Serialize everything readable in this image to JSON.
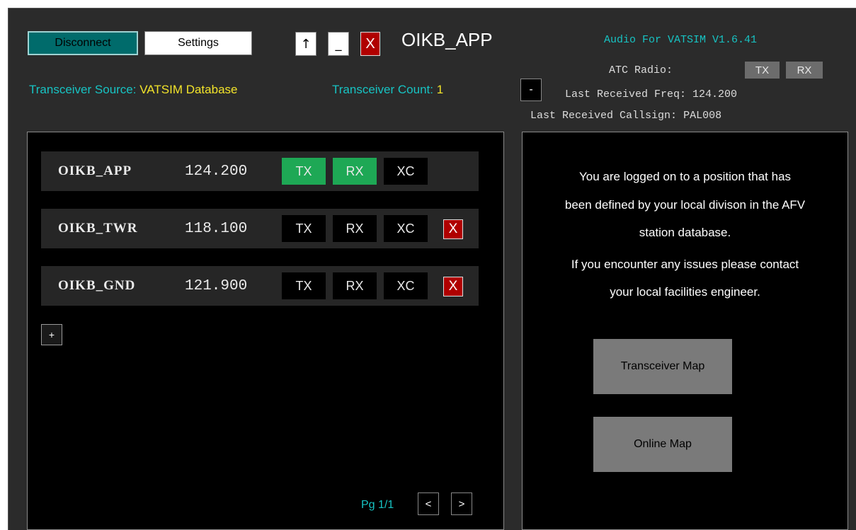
{
  "toolbar": {
    "disconnect_label": "Disconnect",
    "settings_label": "Settings",
    "pin_glyph": "↑",
    "minimize_glyph": "_",
    "close_glyph": "X",
    "callsign": "OIKB_APP"
  },
  "info": {
    "source_label": "Transceiver Source:",
    "source_value": "VATSIM Database",
    "count_label": "Transceiver Count:",
    "count_value": "1"
  },
  "status": {
    "app_title": "Audio For VATSIM V1.6.41",
    "atc_radio_label": "ATC Radio:",
    "tx_label": "TX",
    "rx_label": "RX",
    "collapse_glyph": "-",
    "last_freq_label": "Last Received Freq:",
    "last_freq_value": "124.200",
    "last_callsign_label": "Last Received Callsign:",
    "last_callsign_value": "PAL008"
  },
  "stations": [
    {
      "callsign": "OIKB_APP",
      "freq": "124.200",
      "tx": "TX",
      "rx": "RX",
      "xc": "XC",
      "tx_on": true,
      "rx_on": true,
      "removable": false
    },
    {
      "callsign": "OIKB_TWR",
      "freq": "118.100",
      "tx": "TX",
      "rx": "RX",
      "xc": "XC",
      "tx_on": false,
      "rx_on": false,
      "removable": true,
      "remove_glyph": "X"
    },
    {
      "callsign": "OIKB_GND",
      "freq": "121.900",
      "tx": "TX",
      "rx": "RX",
      "xc": "XC",
      "tx_on": false,
      "rx_on": false,
      "removable": true,
      "remove_glyph": "X"
    }
  ],
  "station_list": {
    "add_glyph": "+",
    "page_label": "Pg 1/1",
    "prev_glyph": "<",
    "next_glyph": ">"
  },
  "notice": {
    "line1": "You are logged on to a position that has",
    "line2": "been defined by your local divison in the AFV",
    "line3": "station database.",
    "line4": "If you encounter any issues please contact",
    "line5": "your local facilities engineer.",
    "transceiver_map_label": "Transceiver Map",
    "online_map_label": "Online Map"
  },
  "colors": {
    "accent_cyan": "#17c3c3",
    "accent_yellow": "#f2e32a",
    "active_green": "#1ea855",
    "close_red": "#b00000",
    "disconnect_teal": "#006b6b"
  }
}
